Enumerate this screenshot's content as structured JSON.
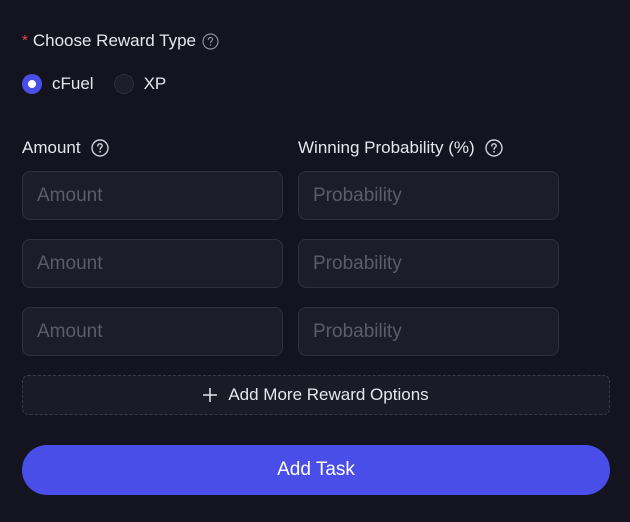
{
  "reward_type": {
    "label": "Choose Reward Type",
    "required_marker": "*",
    "help_icon": "question-circle-icon",
    "options": [
      {
        "label": "cFuel",
        "selected": true
      },
      {
        "label": "XP",
        "selected": false
      }
    ]
  },
  "columns": {
    "amount_label": "Amount",
    "probability_label": "Winning Probability (%)",
    "help_icon": "question-circle-icon"
  },
  "rows": [
    {
      "amount_placeholder": "Amount",
      "amount_value": "",
      "probability_placeholder": "Probability",
      "probability_value": ""
    },
    {
      "amount_placeholder": "Amount",
      "amount_value": "",
      "probability_placeholder": "Probability",
      "probability_value": ""
    },
    {
      "amount_placeholder": "Amount",
      "amount_value": "",
      "probability_placeholder": "Probability",
      "probability_value": ""
    }
  ],
  "add_more": {
    "label": "Add More Reward Options",
    "icon": "plus-icon"
  },
  "submit": {
    "label": "Add Task"
  },
  "colors": {
    "background": "#141420",
    "accent": "#4a4ee8",
    "input_bg": "#1d1d29",
    "required": "#e5484d"
  }
}
